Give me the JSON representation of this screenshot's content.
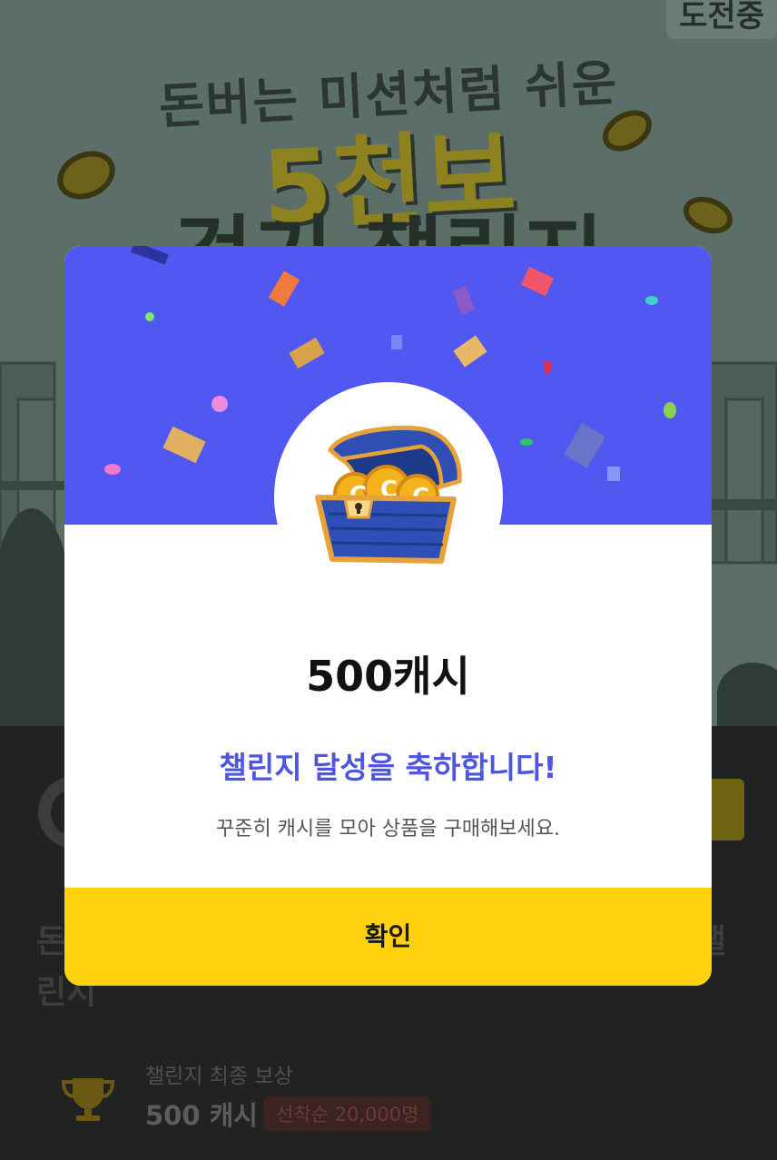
{
  "background": {
    "hero_subtitle": "돈버는 미션처럼 쉬운",
    "hero_title_big": "5천보",
    "hero_title_line2": "걷기 챌린지",
    "corner_badge": "도전중",
    "page_title_fragment_left": "돈",
    "page_title_fragment_right": "챌",
    "page_title_line2": "린지",
    "reward_label": "챌린지 최종 보상",
    "reward_amount": "500 캐시",
    "reward_badge": "선착순 20,000명",
    "icons": [
      "trophy-icon",
      "coin-icon"
    ]
  },
  "modal": {
    "amount": "500캐시",
    "congrats": "챌린지 달성을 축하합니다!",
    "message": "꾸준히 캐시를 모아 상품을 구매해보세요.",
    "confirm_label": "확인",
    "illustration": "treasure-chest-icon"
  },
  "colors": {
    "header_blue": "#5058f1",
    "accent_yellow": "#ffd20d",
    "congrats_text": "#4e55e0"
  }
}
